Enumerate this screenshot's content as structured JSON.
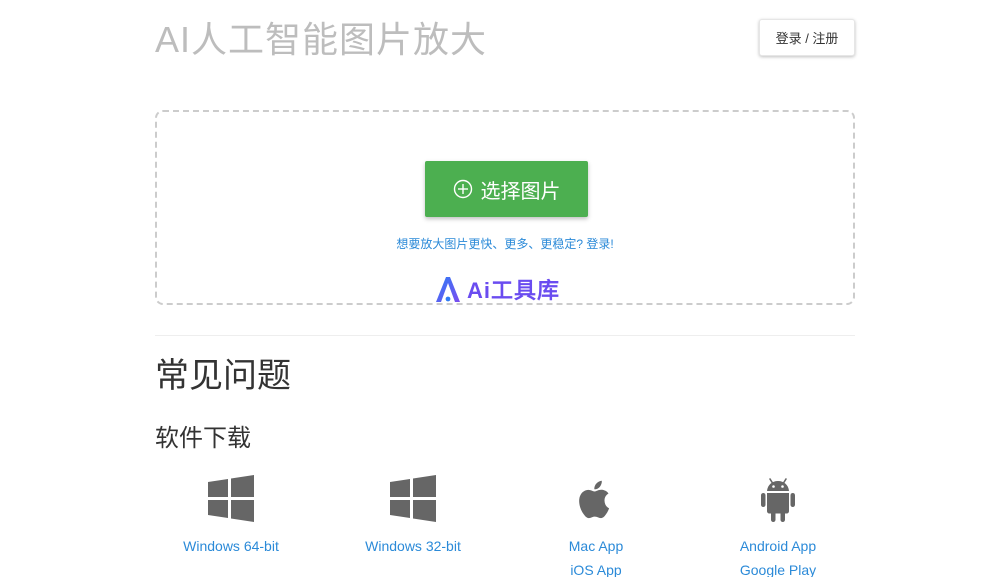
{
  "header": {
    "title": "AI人工智能图片放大",
    "login_label": "登录 / 注册"
  },
  "upload": {
    "select_label": "选择图片",
    "upgrade_text": "想要放大图片更快、更多、更稳定? 登录!",
    "watermark_text": "Ai工具库"
  },
  "faq": {
    "title": "常见问题",
    "software_title": "软件下载"
  },
  "downloads": [
    {
      "icon": "windows-icon",
      "links": [
        "Windows 64-bit"
      ]
    },
    {
      "icon": "windows-icon",
      "links": [
        "Windows 32-bit"
      ]
    },
    {
      "icon": "apple-icon",
      "links": [
        "Mac App",
        "iOS App"
      ]
    },
    {
      "icon": "android-icon",
      "links": [
        "Android App",
        "Google Play"
      ]
    }
  ],
  "colors": {
    "primary_button": "#4caf50",
    "link": "#2b8ad8",
    "title_gray": "#bdbdbd",
    "icon_gray": "#666666",
    "watermark": "#6a4cf0"
  }
}
